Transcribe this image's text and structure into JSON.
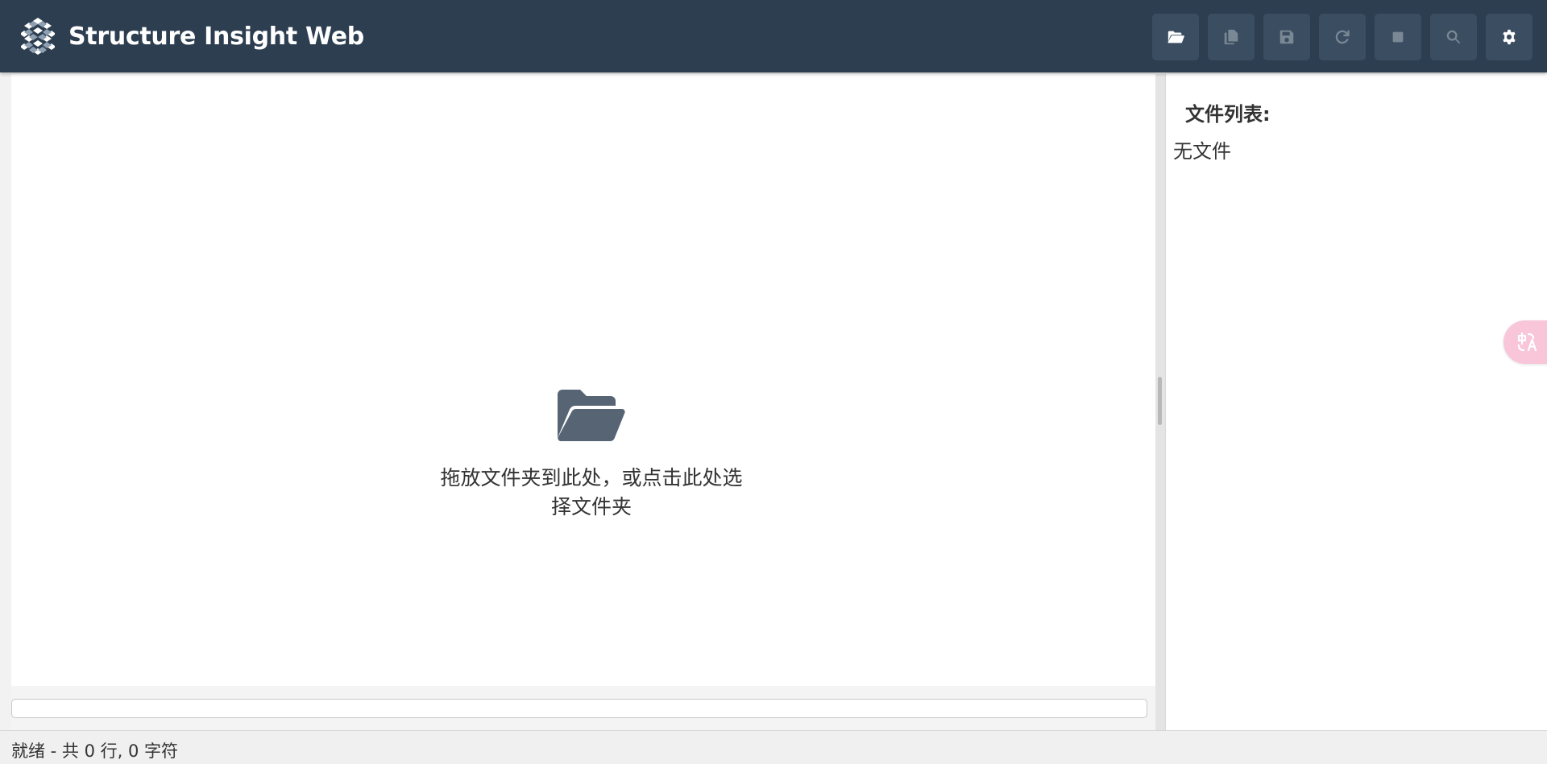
{
  "app": {
    "title": "Structure Insight Web",
    "logo_icon": "cube-pattern-logo"
  },
  "toolbar": {
    "buttons": [
      {
        "icon": "folder-open-icon",
        "state": "enabled"
      },
      {
        "icon": "copy-icon",
        "state": "disabled"
      },
      {
        "icon": "save-icon",
        "state": "disabled"
      },
      {
        "icon": "refresh-icon",
        "state": "disabled"
      },
      {
        "icon": "stop-icon",
        "state": "disabled"
      },
      {
        "icon": "search-icon",
        "state": "disabled"
      },
      {
        "icon": "gear-icon",
        "state": "enabled"
      }
    ]
  },
  "main": {
    "drop_zone": {
      "icon": "folder-open-icon",
      "text": "拖放文件夹到此处，或点击此处选择文件夹"
    },
    "progress": {
      "value": 0
    }
  },
  "side_panel": {
    "title": "文件列表:",
    "empty_text": "无文件"
  },
  "floating": {
    "translate_icon": "translate-icon"
  },
  "status_bar": {
    "text": "就绪 - 共 0 行, 0 字符"
  },
  "colors": {
    "header_bg": "#2c3e50",
    "button_bg": "#3b4d60",
    "icon_active": "#ffffff",
    "icon_disabled": "#7a8795",
    "folder_icon": "#566474",
    "translate_fab": "#f8c6d8"
  }
}
